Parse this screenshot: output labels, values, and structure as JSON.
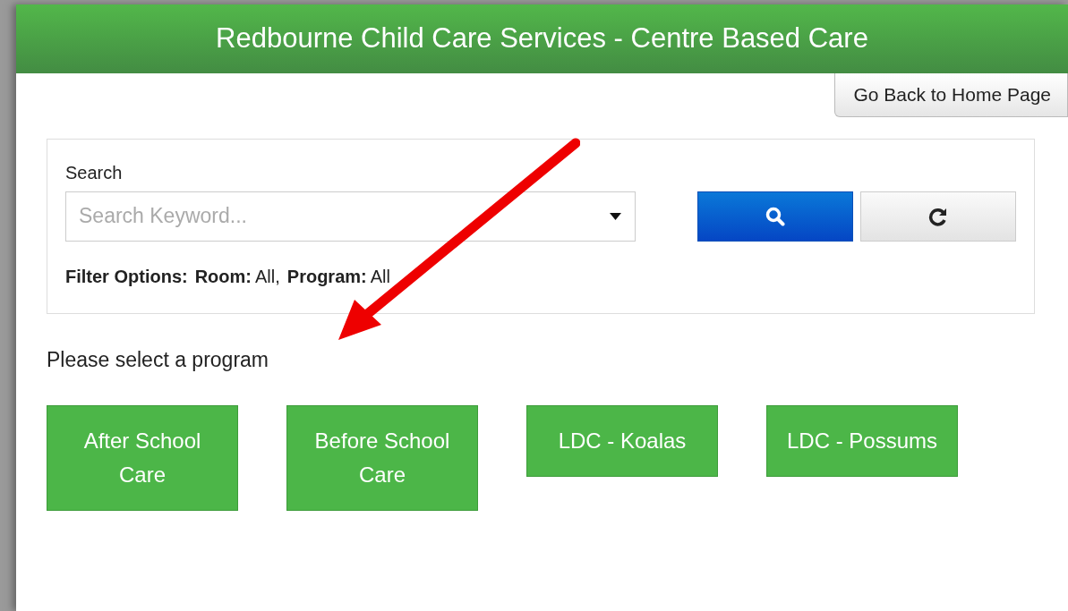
{
  "header": {
    "title": "Redbourne Child Care Services - Centre Based Care"
  },
  "home_button": {
    "label": "Go Back to Home Page"
  },
  "search": {
    "label": "Search",
    "placeholder": "Search Keyword..."
  },
  "filter_options": {
    "label": "Filter Options:",
    "items": [
      {
        "label": "Room:",
        "value": "All,"
      },
      {
        "label": "Program:",
        "value": "All"
      }
    ]
  },
  "prompt": "Please select a program",
  "programs": [
    {
      "label": "After School Care"
    },
    {
      "label": "Before School Care"
    },
    {
      "label": "LDC - Koalas"
    },
    {
      "label": "LDC - Possums"
    }
  ]
}
